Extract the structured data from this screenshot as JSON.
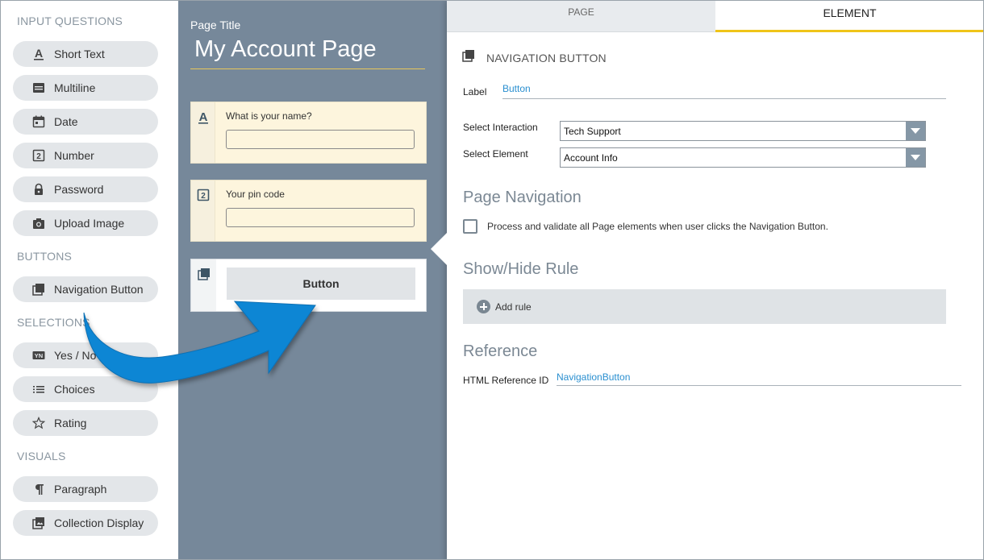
{
  "palette": {
    "headings": {
      "input": "INPUT QUESTIONS",
      "buttons": "BUTTONS",
      "selections": "SELECTIONS",
      "visuals": "VISUALS"
    },
    "items": {
      "short_text": "Short Text",
      "multiline": "Multiline",
      "date": "Date",
      "number": "Number",
      "password": "Password",
      "upload_image": "Upload Image",
      "navigation_button": "Navigation Button",
      "yes_no": "Yes / No",
      "choices": "Choices",
      "rating": "Rating",
      "paragraph": "Paragraph",
      "collection_display": "Collection Display"
    }
  },
  "canvas": {
    "page_title_label": "Page Title",
    "page_title_value": "My Account Page",
    "questions": [
      {
        "text": "What is your name?",
        "icon": "text-a-icon"
      },
      {
        "text": "Your pin code",
        "icon": "number-icon"
      }
    ],
    "button_preview_label": "Button"
  },
  "properties": {
    "tabs": {
      "page": "PAGE",
      "element": "ELEMENT"
    },
    "active_tab": "ELEMENT",
    "section_title": "NAVIGATION BUTTON",
    "label_field": {
      "label": "Label",
      "value": "Button"
    },
    "select_interaction": {
      "label": "Select Interaction",
      "value": "Tech Support"
    },
    "select_element": {
      "label": "Select Element",
      "value": "Account Info"
    },
    "page_navigation": {
      "heading": "Page Navigation",
      "checkbox_text": "Process and validate all Page elements when user clicks the Navigation Button.",
      "checked": false
    },
    "show_hide": {
      "heading": "Show/Hide Rule",
      "add_rule": "Add rule"
    },
    "reference": {
      "heading": "Reference",
      "html_ref_label": "HTML Reference ID",
      "html_ref_value": "NavigationButton"
    }
  },
  "colors": {
    "canvas_bg": "#76889a",
    "palette_button_bg": "#e3e6e9",
    "question_card_bg": "#fdf5dd",
    "active_tab_underline": "#f0c419",
    "link_blue": "#2a8fd0",
    "arrow_blue": "#0e86d4"
  }
}
